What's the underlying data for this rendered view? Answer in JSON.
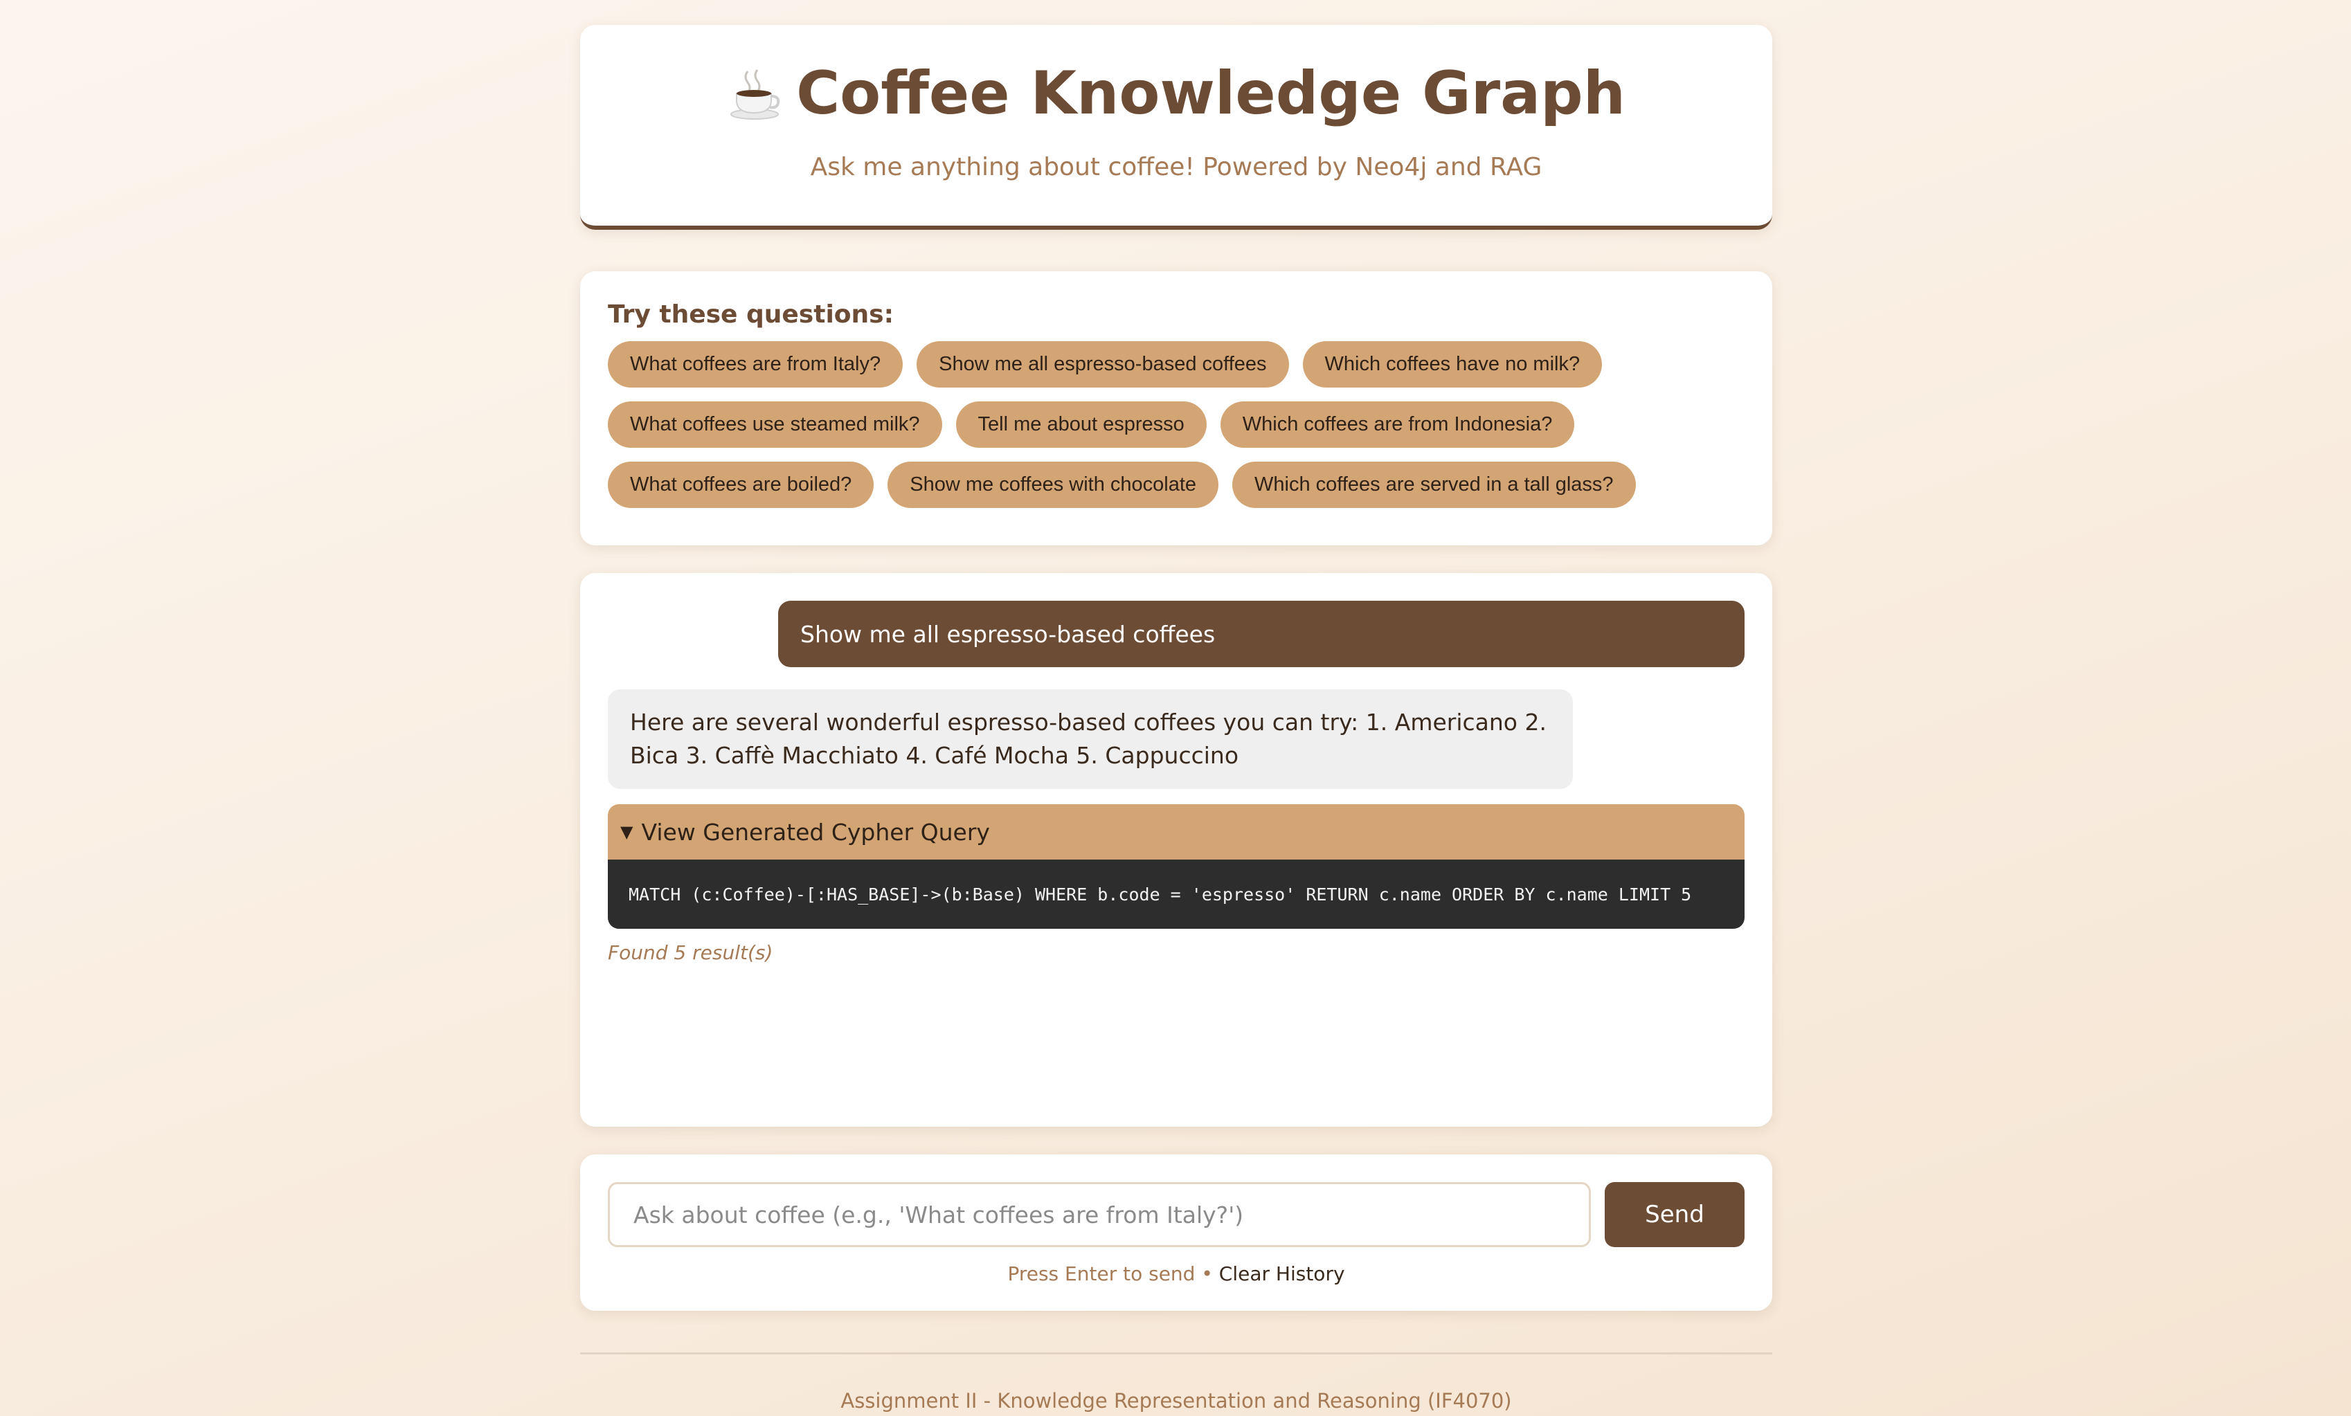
{
  "header": {
    "title": "Coffee Knowledge Graph",
    "subtitle": "Ask me anything about coffee! Powered by Neo4j and RAG",
    "icon": "coffee-cup-icon"
  },
  "examples": {
    "heading": "Try these questions:",
    "chips": [
      "What coffees are from Italy?",
      "Show me all espresso-based coffees",
      "Which coffees have no milk?",
      "What coffees use steamed milk?",
      "Tell me about espresso",
      "Which coffees are from Indonesia?",
      "What coffees are boiled?",
      "Show me coffees with chocolate",
      "Which coffees are served in a tall glass?"
    ]
  },
  "chat": {
    "user_message": "Show me all espresso-based coffees",
    "bot_message": "Here are several wonderful espresso-based coffees you can try: 1. Americano 2. Bica 3. Caffè Macchiato 4. Café Mocha 5. Cappuccino",
    "cypher_summary": "View Generated Cypher Query",
    "cypher_query": "MATCH (c:Coffee)-[:HAS_BASE]->(b:Base) WHERE b.code = 'espresso' RETURN c.name ORDER BY c.name LIMIT 5",
    "found_text": "Found 5 result(s)"
  },
  "input": {
    "placeholder": "Ask about coffee (e.g., 'What coffees are from Italy?')",
    "value": "",
    "send_label": "Send",
    "hint_text": "Press Enter to send",
    "separator": "•",
    "clear_label": "Clear History"
  },
  "footer": {
    "text": "Assignment II - Knowledge Representation and Reasoning (IF4070)"
  },
  "colors": {
    "brand_brown": "#6d4c36",
    "chip_tan": "#d4a574",
    "muted_text": "#a57a54",
    "code_bg": "#2d2d2d"
  }
}
